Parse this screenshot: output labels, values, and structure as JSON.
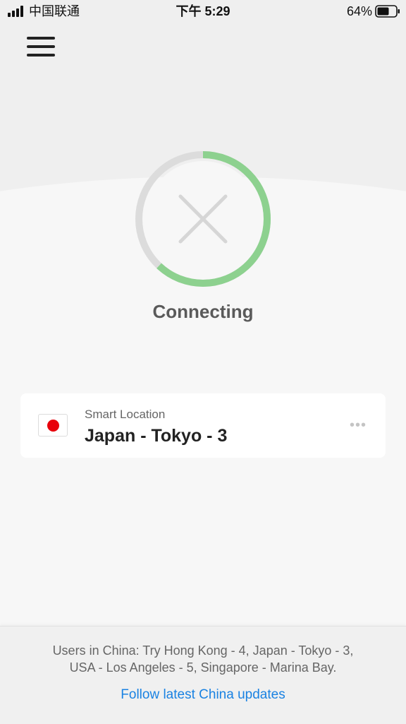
{
  "status_bar": {
    "carrier": "中国联通",
    "time": "下午 5:29",
    "battery_percent": "64%",
    "battery_level": 0.64
  },
  "header": {
    "menu_icon": "hamburger-menu-icon"
  },
  "connection": {
    "status": "Connecting",
    "icon": "close-x-icon",
    "progress": 0.62,
    "progress_color": "#8dd18f",
    "track_color": "#dcdcdc"
  },
  "location": {
    "label": "Smart Location",
    "name": "Japan - Tokyo - 3",
    "flag_icon": "japan-flag-icon",
    "more_icon": "more-dots-icon"
  },
  "footer": {
    "notice_line1": "Users in China: Try Hong Kong - 4, Japan - Tokyo - 3,",
    "notice_line2": "USA - Los Angeles - 5, Singapore - Marina Bay.",
    "link": "Follow latest China updates",
    "link_color": "#1a82e2"
  }
}
